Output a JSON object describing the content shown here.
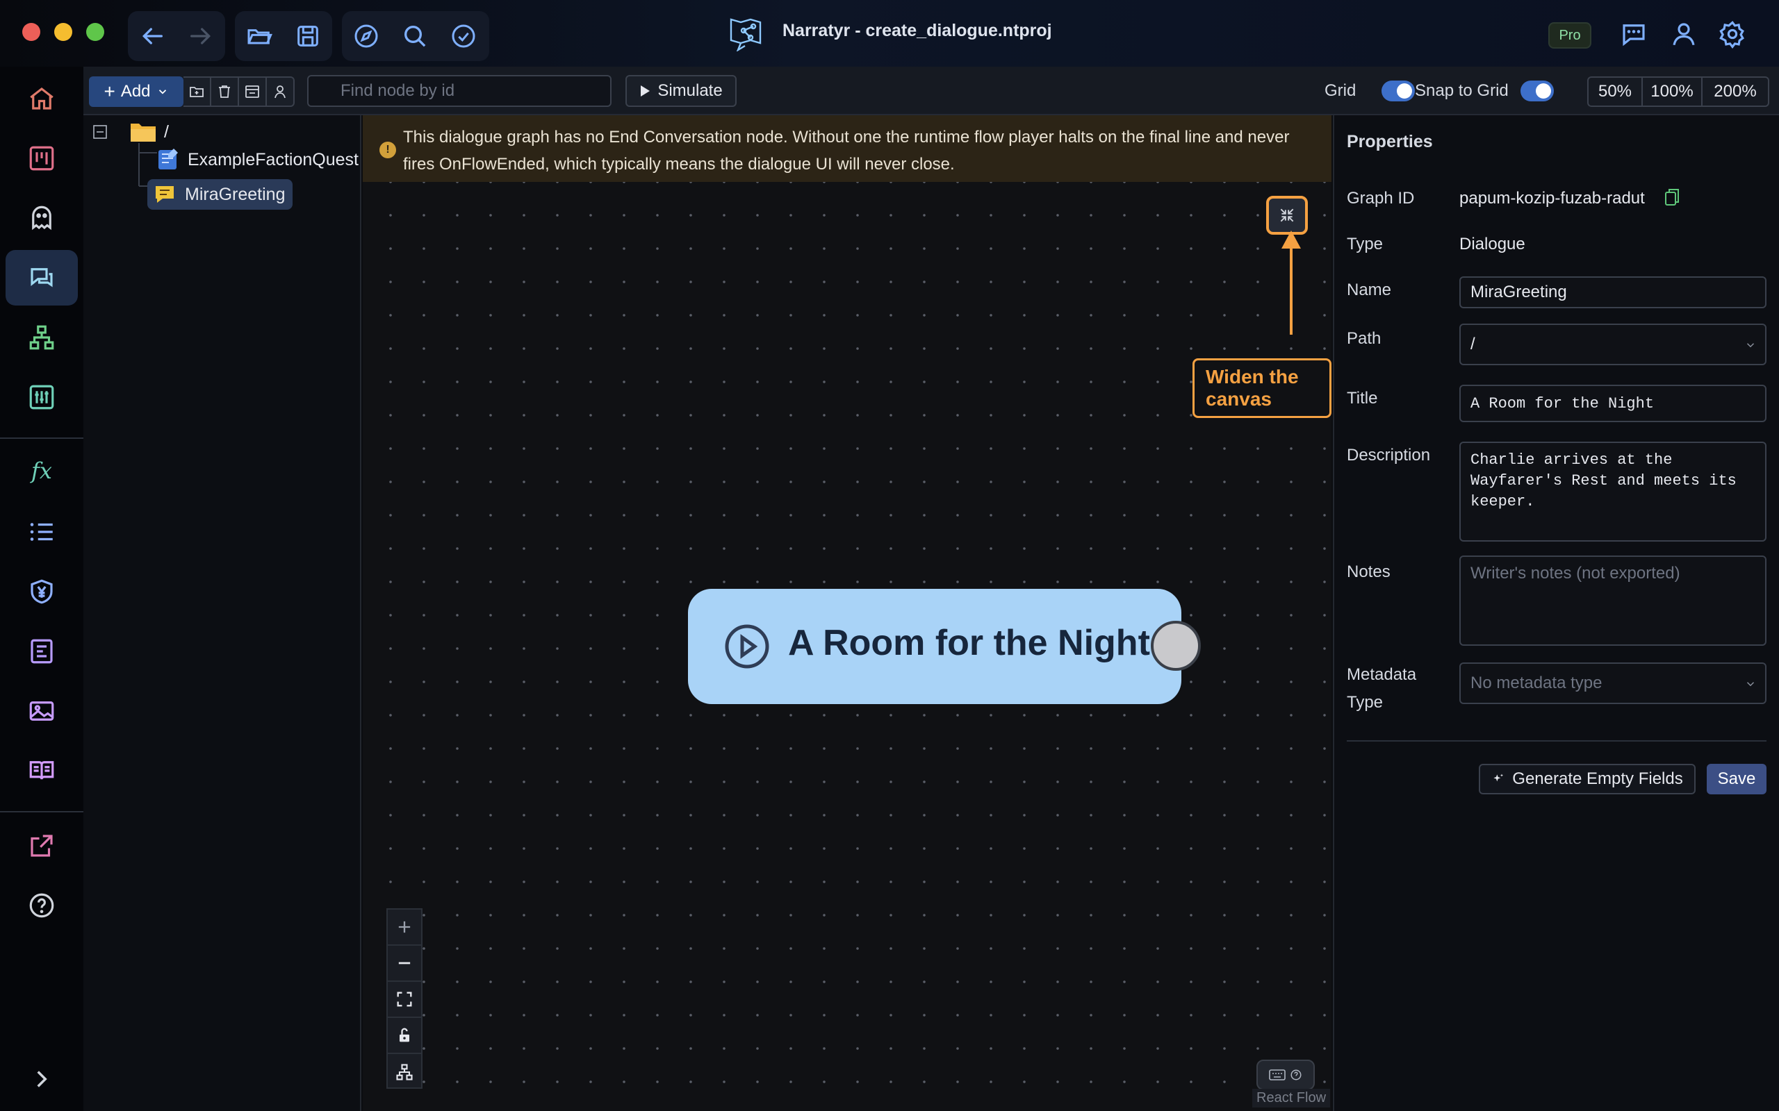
{
  "window": {
    "title": "Narratyr - create_dialogue.ntproj",
    "badge": "Pro"
  },
  "toolbar": {
    "add_label": "Add",
    "search_placeholder": "Find node by id",
    "simulate_label": "Simulate",
    "grid_label": "Grid",
    "snap_label": "Snap to Grid",
    "grid_on": true,
    "snap_on": true,
    "zoom_options": [
      "50%",
      "100%",
      "200%"
    ]
  },
  "tree": {
    "root": "/",
    "items": [
      {
        "label": "ExampleFactionQuest",
        "icon": "quest-icon",
        "selected": false
      },
      {
        "label": "MiraGreeting",
        "icon": "dialogue-icon",
        "selected": true
      }
    ]
  },
  "canvas": {
    "warning": "This dialogue graph has no End Conversation node. Without one the runtime flow player halts on the final line and never fires OnFlowEnded, which typically means the dialogue UI will never close.",
    "callout": "Widen the canvas",
    "node_title": "A Room for the Night",
    "attribution": "React Flow"
  },
  "properties": {
    "heading": "Properties",
    "graph_id_label": "Graph ID",
    "graph_id": "papum-kozip-fuzab-radut",
    "type_label": "Type",
    "type": "Dialogue",
    "name_label": "Name",
    "name": "MiraGreeting",
    "path_label": "Path",
    "path": "/",
    "title_label": "Title",
    "title": "A Room for the Night",
    "description_label": "Description",
    "description": "Charlie arrives at the Wayfarer's Rest and meets its keeper.",
    "notes_label": "Notes",
    "notes_placeholder": "Writer's notes (not exported)",
    "metadata_label_1": "Metadata",
    "metadata_label_2": "Type",
    "metadata_placeholder": "No metadata type",
    "generate_label": "Generate Empty Fields",
    "save_label": "Save"
  },
  "colors": {
    "accent": "#f5a142",
    "node": "#a9d3f7",
    "primary": "#27477e"
  }
}
